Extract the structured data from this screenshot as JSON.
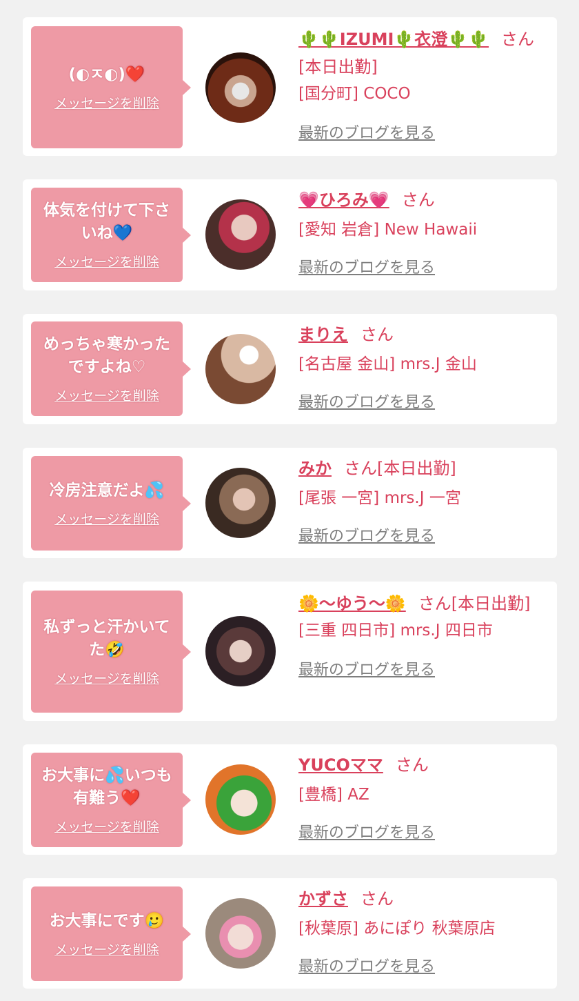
{
  "messages": [
    {
      "message": "(◐ㅈ◐)❤️",
      "delete_label": "メッセージを削除",
      "name": "🌵🌵IZUMI🌵衣澄🌵🌵",
      "suffix": "さん[本日出勤]",
      "shop": "[国分町] COCO",
      "blog_label": "最新のブログを見る"
    },
    {
      "message": "体気を付けて下さいね💙",
      "delete_label": "メッセージを削除",
      "name": "💗ひろみ💗",
      "suffix": "さん",
      "shop": "[愛知 岩倉] New Hawaii",
      "blog_label": "最新のブログを見る"
    },
    {
      "message": "めっちゃ寒かったですよね♡",
      "delete_label": "メッセージを削除",
      "name": "まりえ",
      "suffix": "さん",
      "shop": "[名古屋 金山] mrs.J 金山",
      "blog_label": "最新のブログを見る"
    },
    {
      "message": "冷房注意だよ💦",
      "delete_label": "メッセージを削除",
      "name": "みか",
      "suffix": "さん[本日出勤]",
      "shop": "[尾張 一宮] mrs.J 一宮",
      "blog_label": "最新のブログを見る"
    },
    {
      "message": "私ずっと汗かいてた🤣",
      "delete_label": "メッセージを削除",
      "name": "🌼〜ゆう〜🌼",
      "suffix": "さん[本日出勤]",
      "shop": "[三重 四日市] mrs.J 四日市",
      "blog_label": "最新のブログを見る"
    },
    {
      "message": "お大事に💦いつも有難う❤️",
      "delete_label": "メッセージを削除",
      "name": "YUCOママ",
      "suffix": "さん",
      "shop": "[豊橋] AZ",
      "blog_label": "最新のブログを見る"
    },
    {
      "message": "お大事にです🥲",
      "delete_label": "メッセージを削除",
      "name": "かずさ",
      "suffix": "さん",
      "shop": "[秋葉原] あにぽり 秋葉原店",
      "blog_label": "最新のブログを見る"
    }
  ]
}
